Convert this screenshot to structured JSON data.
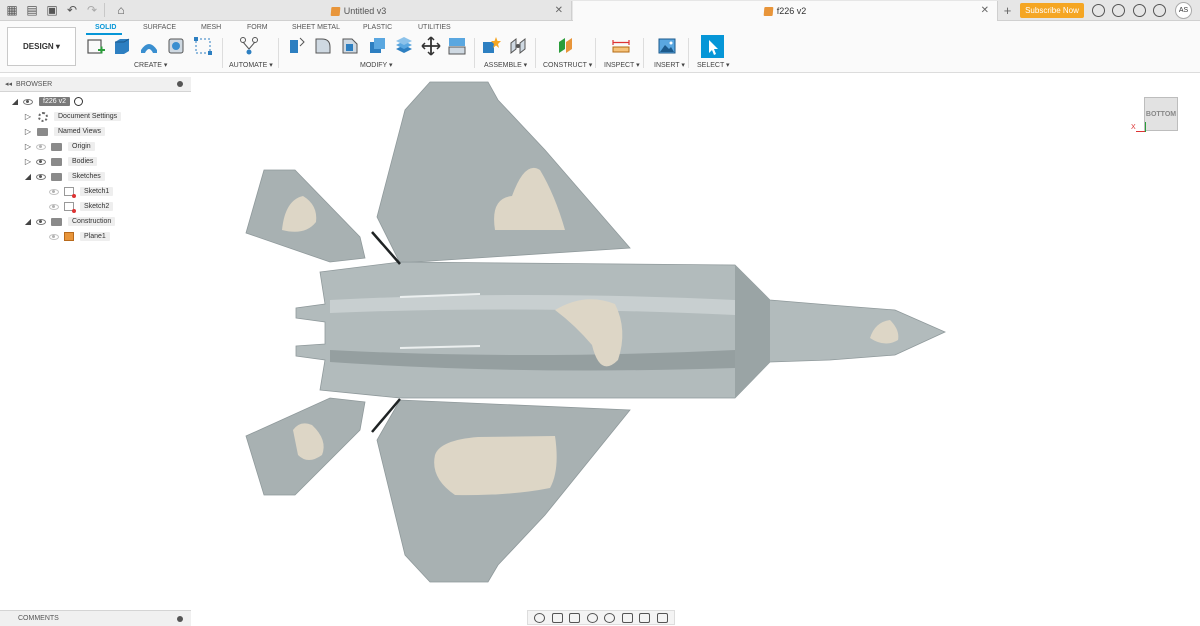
{
  "titlebar": {
    "tabs": [
      {
        "label": "Untitled v3",
        "active": false
      },
      {
        "label": "f226 v2",
        "active": true
      }
    ],
    "subscribe_label": "Subscribe Now",
    "user_initials": "AS"
  },
  "toolbar": {
    "design_label": "DESIGN ▾",
    "tabs": [
      "SOLID",
      "SURFACE",
      "MESH",
      "FORM",
      "SHEET METAL",
      "PLASTIC",
      "UTILITIES"
    ],
    "groups": {
      "create": "CREATE ▾",
      "automate": "AUTOMATE ▾",
      "modify": "MODIFY ▾",
      "assemble": "ASSEMBLE ▾",
      "construct": "CONSTRUCT ▾",
      "inspect": "INSPECT ▾",
      "insert": "INSERT ▾",
      "select": "SELECT ▾"
    }
  },
  "browser": {
    "title": "BROWSER",
    "root": "f226 v2",
    "items": [
      {
        "label": "Document Settings"
      },
      {
        "label": "Named Views"
      },
      {
        "label": "Origin"
      },
      {
        "label": "Bodies"
      },
      {
        "label": "Sketches"
      },
      {
        "label": "Sketch1"
      },
      {
        "label": "Sketch2"
      },
      {
        "label": "Construction"
      },
      {
        "label": "Plane1"
      }
    ]
  },
  "comments": {
    "title": "COMMENTS"
  },
  "viewcube": {
    "face": "BOTTOM",
    "axis_x": "X"
  },
  "colors": {
    "accent": "#0696d7",
    "subscribe": "#f5a623",
    "model_body": "#a8b1b2",
    "model_panel": "#ddd6c6"
  }
}
